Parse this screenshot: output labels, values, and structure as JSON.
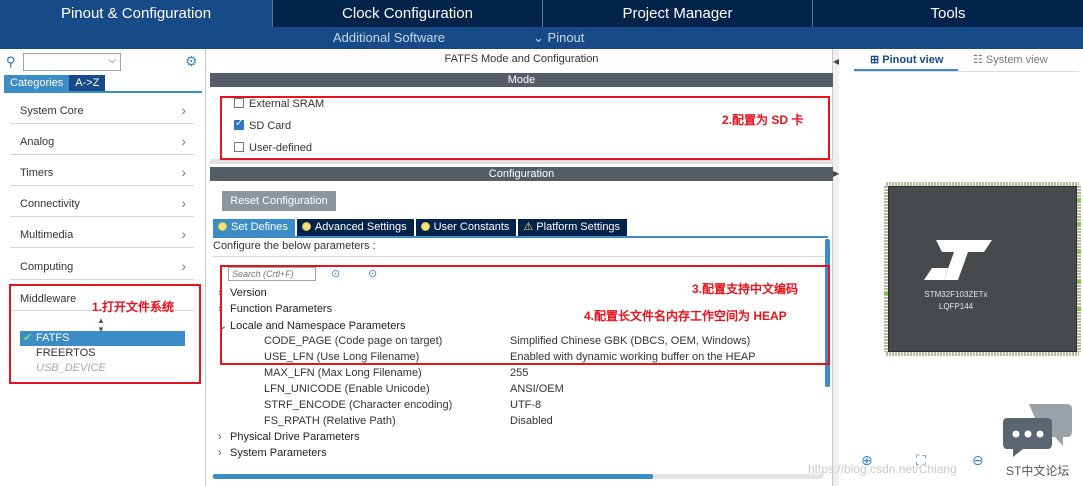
{
  "top_tabs": [
    "Pinout & Configuration",
    "Clock Configuration",
    "Project Manager",
    "Tools"
  ],
  "sub_bar": {
    "additional_software": "Additional Software",
    "pinout": "Pinout"
  },
  "left": {
    "cat_tabs": [
      "Categories",
      "A->Z"
    ],
    "categories": [
      "System Core",
      "Analog",
      "Timers",
      "Connectivity",
      "Multimedia",
      "Computing"
    ],
    "middleware_label": "Middleware",
    "middleware_items": [
      "FATFS",
      "FREERTOS",
      "USB_DEVICE"
    ]
  },
  "mid": {
    "title": "FATFS Mode and Configuration",
    "mode_header": "Mode",
    "mode_options": [
      {
        "label": "External SRAM",
        "checked": false
      },
      {
        "label": "SD Card",
        "checked": true
      },
      {
        "label": "User-defined",
        "checked": false
      }
    ],
    "config_header": "Configuration",
    "reset_button": "Reset Configuration",
    "cfg_tabs": [
      "Set Defines",
      "Advanced Settings",
      "User Constants",
      "Platform Settings"
    ],
    "cfg_desc": "Configure the below parameters :",
    "search_placeholder": "Search (Crtl+F)",
    "tree": [
      "Version",
      "Function Parameters",
      "Locale and Namespace Parameters"
    ],
    "params": [
      {
        "name": "CODE_PAGE (Code page on target)",
        "value": "Simplified Chinese GBK (DBCS, OEM, Windows)"
      },
      {
        "name": "USE_LFN (Use Long Filename)",
        "value": "Enabled with dynamic working buffer on the HEAP"
      },
      {
        "name": "MAX_LFN (Max Long Filename)",
        "value": "255"
      },
      {
        "name": "LFN_UNICODE (Enable Unicode)",
        "value": "ANSI/OEM"
      },
      {
        "name": "STRF_ENCODE (Character encoding)",
        "value": "UTF-8"
      },
      {
        "name": "FS_RPATH (Relative Path)",
        "value": "Disabled"
      }
    ],
    "tree_bottom": [
      "Physical Drive Parameters",
      "System Parameters"
    ]
  },
  "annotations": {
    "a1": "1.打开文件系统",
    "a2": "2.配置为 SD 卡",
    "a3": "3.配置支持中文编码",
    "a4": "4.配置长文件名内存工作空间为 HEAP"
  },
  "right": {
    "views": [
      "Pinout view",
      "System view"
    ],
    "chip_name": "STM32F103ZETx",
    "chip_package": "LQFP144",
    "watermark": "https://blog.csdn.net/Chiang",
    "wm_bold": "ST中文论坛"
  },
  "colors": {
    "accent": "#3c8cc5",
    "navy": "#03234b",
    "annotation": "#e8131e"
  }
}
